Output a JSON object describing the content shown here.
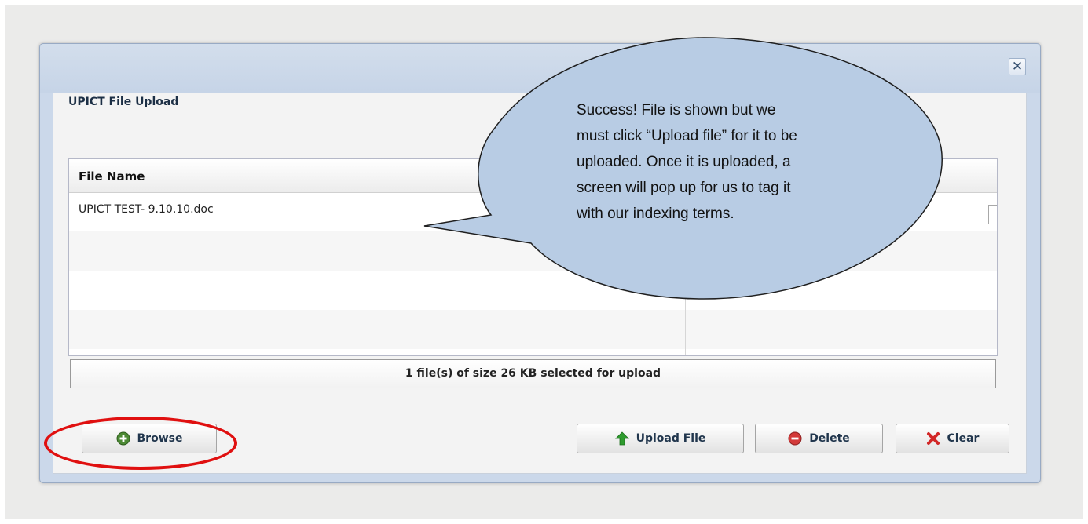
{
  "dialog": {
    "close_symbol": "✕",
    "panel_title": "UPICT File Upload"
  },
  "grid": {
    "columns": [
      "File Name"
    ],
    "rows": [
      {
        "file_name": "UPICT TEST- 9.10.10.doc"
      }
    ]
  },
  "status_text": "1 file(s) of size 26 KB selected for upload",
  "buttons": {
    "browse": "Browse",
    "upload": "Upload File",
    "delete": "Delete",
    "clear": "Clear"
  },
  "callout": {
    "lines": [
      "Success!  File is shown but we",
      "must click “Upload file” for it to be",
      "uploaded.  Once it is uploaded, a",
      "screen will pop up for us to tag it",
      "with our indexing terms."
    ]
  },
  "icons": {
    "browse": "plus-circle-icon",
    "upload": "up-arrow-icon",
    "delete": "minus-circle-icon",
    "clear": "red-x-icon",
    "close": "close-icon"
  },
  "colors": {
    "dialog_title": "#c6d4e7",
    "callout_fill": "#b8cce4",
    "callout_stroke": "#1f1f1f",
    "highlight": "#e01010",
    "upload_arrow": "#2e9b2e",
    "delete_icon": "#d33a3a",
    "browse_icon": "#4d8a35"
  }
}
